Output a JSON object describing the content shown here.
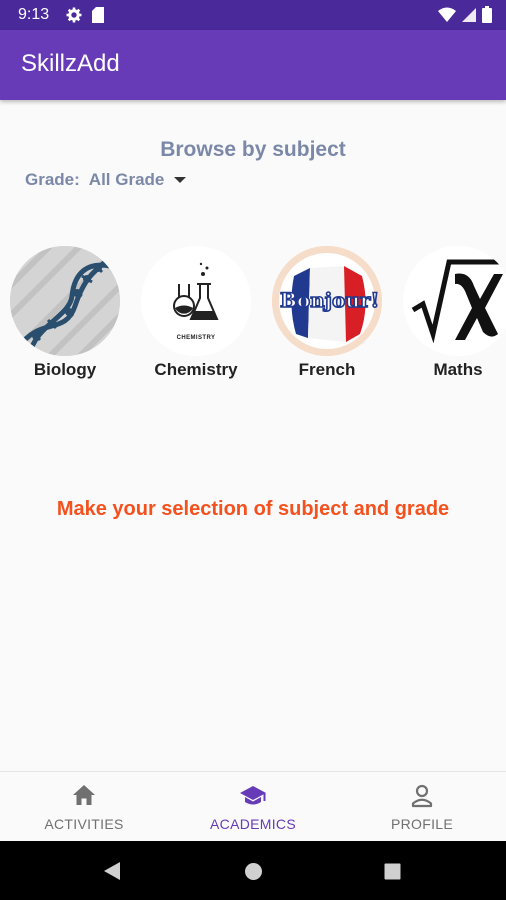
{
  "status_bar": {
    "time": "9:13",
    "icons": [
      "settings-gear-icon",
      "sd-card-icon",
      "wifi-icon",
      "cell-signal-icon",
      "battery-icon"
    ]
  },
  "app_bar": {
    "title": "SkillzAdd"
  },
  "browse": {
    "title": "Browse by subject",
    "grade_label": "Grade:",
    "grade_value": "All Grade"
  },
  "subjects": [
    {
      "label": "Biology",
      "icon": "dna-icon"
    },
    {
      "label": "Chemistry",
      "icon": "lab-flasks-icon",
      "caption": "CHEMISTRY"
    },
    {
      "label": "French",
      "icon": "bonjour-flag-icon",
      "caption": "Bonjour!"
    },
    {
      "label": "Maths",
      "icon": "square-root-x-icon"
    }
  ],
  "message": "Make your selection of subject and grade",
  "bottom_nav": {
    "items": [
      {
        "label": "ACTIVITIES",
        "icon": "home-icon",
        "active": false
      },
      {
        "label": "ACADEMICS",
        "icon": "graduation-cap-icon",
        "active": true
      },
      {
        "label": "PROFILE",
        "icon": "person-icon",
        "active": false
      }
    ]
  },
  "colors": {
    "status_bar": "#4a2a9a",
    "app_bar": "#673ab7",
    "accent": "#673ab7",
    "message": "#f4511e",
    "heading": "#7b88a8"
  }
}
